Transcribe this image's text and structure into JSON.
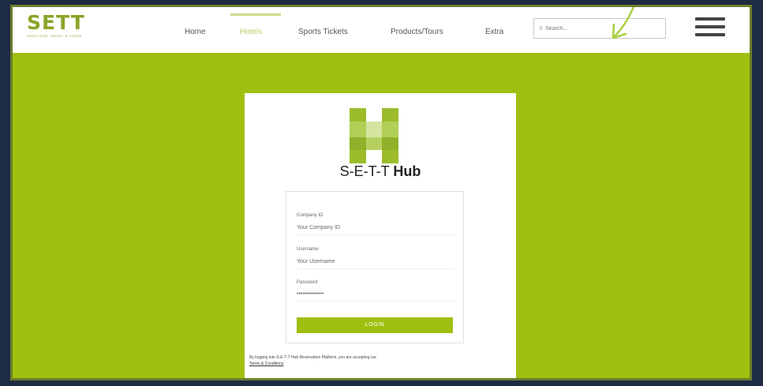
{
  "nav": {
    "logo_text": "SETT",
    "logo_subtext": "EXECUTIVE TRAVEL & TOURS",
    "links": [
      {
        "label": "Home"
      },
      {
        "label": "Hotels"
      },
      {
        "label": "Sports Tickets"
      },
      {
        "label": "Products/Tours"
      },
      {
        "label": "Extra"
      }
    ],
    "search_placeholder": "Search..."
  },
  "colors": {
    "accent": "#a0c010",
    "frame_bg": "#1d2b43",
    "active_link": "#b7cf66"
  },
  "hub": {
    "title_prefix": "S-E-T-T",
    "title_suffix": "Hub"
  },
  "form": {
    "company_label": "Company ID",
    "company_placeholder": "Your Company ID",
    "username_label": "Username",
    "username_placeholder": "Your Username",
    "password_label": "Password",
    "password_value": "••••••••••••••",
    "login_label": "LOGIN"
  },
  "terms": {
    "text": "By logging into S-E-T-T Hub Reservation Platform, you are accepting our",
    "link_label": "Terms & Conditions"
  }
}
